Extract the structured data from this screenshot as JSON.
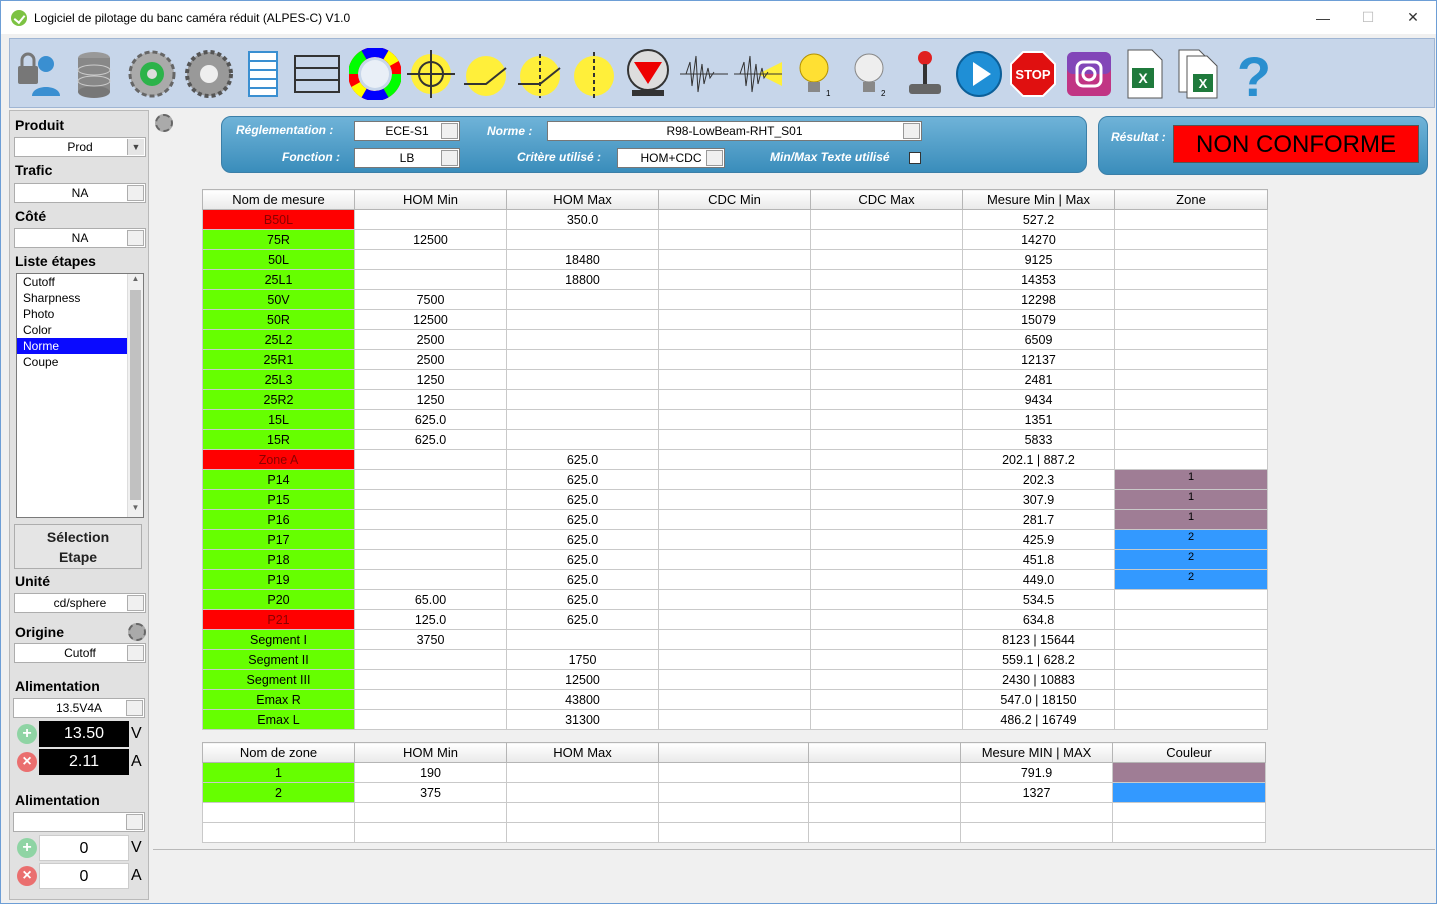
{
  "window": {
    "title": "Logiciel de pilotage du banc caméra réduit (ALPES-C)  V1.0",
    "min": "—",
    "max": "☐",
    "close": "✕"
  },
  "toolbar": [
    "user-lock-icon",
    "database-icon",
    "refresh-gear-icon",
    "gear-icon",
    "list-view-icon",
    "rows-view-icon",
    "color-wheel-icon",
    "crosshair-icon",
    "cutoff-line-icon",
    "cutoff-cross-icon",
    "cutoff-vertical-icon",
    "red-triangle-icon",
    "waveform-icon",
    "waveform-yellow-icon",
    "bulb-on-1-icon",
    "bulb-off-2-icon",
    "joystick-icon",
    "play-icon",
    "stop-icon",
    "camera-icon",
    "excel-icon",
    "excel-multi-icon",
    "help-icon"
  ],
  "left": {
    "produit_label": "Produit",
    "produit_value": "Prod",
    "trafic_label": "Trafic",
    "trafic_value": "NA",
    "cote_label": "Côté",
    "cote_value": "NA",
    "etapes_label": "Liste étapes",
    "etapes": [
      "Cutoff",
      "Sharpness",
      "Photo",
      "Color",
      "Norme",
      "Coupe"
    ],
    "selection_line1": "Sélection",
    "selection_line2": "Etape",
    "unite_label": "Unité",
    "unite_value": "cd/sphere",
    "origine_label": "Origine",
    "origine_value": "Cutoff",
    "alim1_label": "Alimentation",
    "alim1_value": "13.5V4A",
    "alim1_v": "13.50",
    "alim1_a": "2.11",
    "alim2_label": "Alimentation",
    "alim2_value": "",
    "alim2_v": "0",
    "alim2_a": "0",
    "unit_v": "V",
    "unit_a": "A"
  },
  "header": {
    "reglementation_label": "Réglementation :",
    "reglementation_value": "ECE-S1",
    "norme_label": "Norme :",
    "norme_value": "R98-LowBeam-RHT_S01",
    "fonction_label": "Fonction :",
    "fonction_value": "LB",
    "critere_label": "Critère utilisé :",
    "critere_value": "HOM+CDC",
    "minmax_label": "Min/Max Texte utilisé",
    "resultat_label": "Résultat :",
    "resultat_value": "NON CONFORME"
  },
  "measures": {
    "columns": [
      "Nom de mesure",
      "HOM Min",
      "HOM Max",
      "CDC Min",
      "CDC Max",
      "Mesure Min | Max",
      "Zone"
    ],
    "rows": [
      {
        "name": "B50L",
        "status": "r",
        "hmin": "",
        "hmax": "350.0",
        "cmin": "",
        "cmax": "",
        "mes": "527.2",
        "zone": ""
      },
      {
        "name": "75R",
        "status": "g",
        "hmin": "12500",
        "hmax": "",
        "cmin": "",
        "cmax": "",
        "mes": "14270",
        "zone": ""
      },
      {
        "name": "50L",
        "status": "g",
        "hmin": "",
        "hmax": "18480",
        "cmin": "",
        "cmax": "",
        "mes": "9125",
        "zone": ""
      },
      {
        "name": "25L1",
        "status": "g",
        "hmin": "",
        "hmax": "18800",
        "cmin": "",
        "cmax": "",
        "mes": "14353",
        "zone": ""
      },
      {
        "name": "50V",
        "status": "g",
        "hmin": "7500",
        "hmax": "",
        "cmin": "",
        "cmax": "",
        "mes": "12298",
        "zone": ""
      },
      {
        "name": "50R",
        "status": "g",
        "hmin": "12500",
        "hmax": "",
        "cmin": "",
        "cmax": "",
        "mes": "15079",
        "zone": ""
      },
      {
        "name": "25L2",
        "status": "g",
        "hmin": "2500",
        "hmax": "",
        "cmin": "",
        "cmax": "",
        "mes": "6509",
        "zone": ""
      },
      {
        "name": "25R1",
        "status": "g",
        "hmin": "2500",
        "hmax": "",
        "cmin": "",
        "cmax": "",
        "mes": "12137",
        "zone": ""
      },
      {
        "name": "25L3",
        "status": "g",
        "hmin": "1250",
        "hmax": "",
        "cmin": "",
        "cmax": "",
        "mes": "2481",
        "zone": ""
      },
      {
        "name": "25R2",
        "status": "g",
        "hmin": "1250",
        "hmax": "",
        "cmin": "",
        "cmax": "",
        "mes": "9434",
        "zone": ""
      },
      {
        "name": "15L",
        "status": "g",
        "hmin": "625.0",
        "hmax": "",
        "cmin": "",
        "cmax": "",
        "mes": "1351",
        "zone": ""
      },
      {
        "name": "15R",
        "status": "g",
        "hmin": "625.0",
        "hmax": "",
        "cmin": "",
        "cmax": "",
        "mes": "5833",
        "zone": ""
      },
      {
        "name": "Zone A",
        "status": "r",
        "hmin": "",
        "hmax": "625.0",
        "cmin": "",
        "cmax": "",
        "mes": "202.1  |  887.2",
        "zone": ""
      },
      {
        "name": "P14",
        "status": "g",
        "hmin": "",
        "hmax": "625.0",
        "cmin": "",
        "cmax": "",
        "mes": "202.3",
        "zone": "1",
        "zc": "purple"
      },
      {
        "name": "P15",
        "status": "g",
        "hmin": "",
        "hmax": "625.0",
        "cmin": "",
        "cmax": "",
        "mes": "307.9",
        "zone": "1",
        "zc": "purple"
      },
      {
        "name": "P16",
        "status": "g",
        "hmin": "",
        "hmax": "625.0",
        "cmin": "",
        "cmax": "",
        "mes": "281.7",
        "zone": "1",
        "zc": "purple"
      },
      {
        "name": "P17",
        "status": "g",
        "hmin": "",
        "hmax": "625.0",
        "cmin": "",
        "cmax": "",
        "mes": "425.9",
        "zone": "2",
        "zc": "blue"
      },
      {
        "name": "P18",
        "status": "g",
        "hmin": "",
        "hmax": "625.0",
        "cmin": "",
        "cmax": "",
        "mes": "451.8",
        "zone": "2",
        "zc": "blue"
      },
      {
        "name": "P19",
        "status": "g",
        "hmin": "",
        "hmax": "625.0",
        "cmin": "",
        "cmax": "",
        "mes": "449.0",
        "zone": "2",
        "zc": "blue"
      },
      {
        "name": "P20",
        "status": "g",
        "hmin": "65.00",
        "hmax": "625.0",
        "cmin": "",
        "cmax": "",
        "mes": "534.5",
        "zone": ""
      },
      {
        "name": "P21",
        "status": "r",
        "hmin": "125.0",
        "hmax": "625.0",
        "cmin": "",
        "cmax": "",
        "mes": "634.8",
        "zone": ""
      },
      {
        "name": "Segment I",
        "status": "g",
        "hmin": "3750",
        "hmax": "",
        "cmin": "",
        "cmax": "",
        "mes": "8123  |  15644",
        "zone": ""
      },
      {
        "name": "Segment II",
        "status": "g",
        "hmin": "",
        "hmax": "1750",
        "cmin": "",
        "cmax": "",
        "mes": "559.1  |  628.2",
        "zone": ""
      },
      {
        "name": "Segment III",
        "status": "g",
        "hmin": "",
        "hmax": "12500",
        "cmin": "",
        "cmax": "",
        "mes": "2430  |  10883",
        "zone": ""
      },
      {
        "name": "Emax R",
        "status": "g",
        "hmin": "",
        "hmax": "43800",
        "cmin": "",
        "cmax": "",
        "mes": "547.0  |  18150",
        "zone": ""
      },
      {
        "name": "Emax L",
        "status": "g",
        "hmin": "",
        "hmax": "31300",
        "cmin": "",
        "cmax": "",
        "mes": "486.2  |  16749",
        "zone": ""
      }
    ]
  },
  "zones": {
    "columns": [
      "Nom de zone",
      "HOM Min",
      "HOM Max",
      "",
      "",
      "Mesure MIN | MAX",
      "Couleur"
    ],
    "rows": [
      {
        "name": "1",
        "status": "g",
        "hmin": "190",
        "hmax": "",
        "c4": "",
        "c5": "",
        "mes": "791.9",
        "color": "purple"
      },
      {
        "name": "2",
        "status": "g",
        "hmin": "375",
        "hmax": "",
        "c4": "",
        "c5": "",
        "mes": "1327",
        "color": "blue"
      },
      {
        "name": "",
        "status": "",
        "hmin": "",
        "hmax": "",
        "c4": "",
        "c5": "",
        "mes": "",
        "color": ""
      },
      {
        "name": "",
        "status": "",
        "hmin": "",
        "hmax": "",
        "c4": "",
        "c5": "",
        "mes": "",
        "color": ""
      }
    ]
  }
}
